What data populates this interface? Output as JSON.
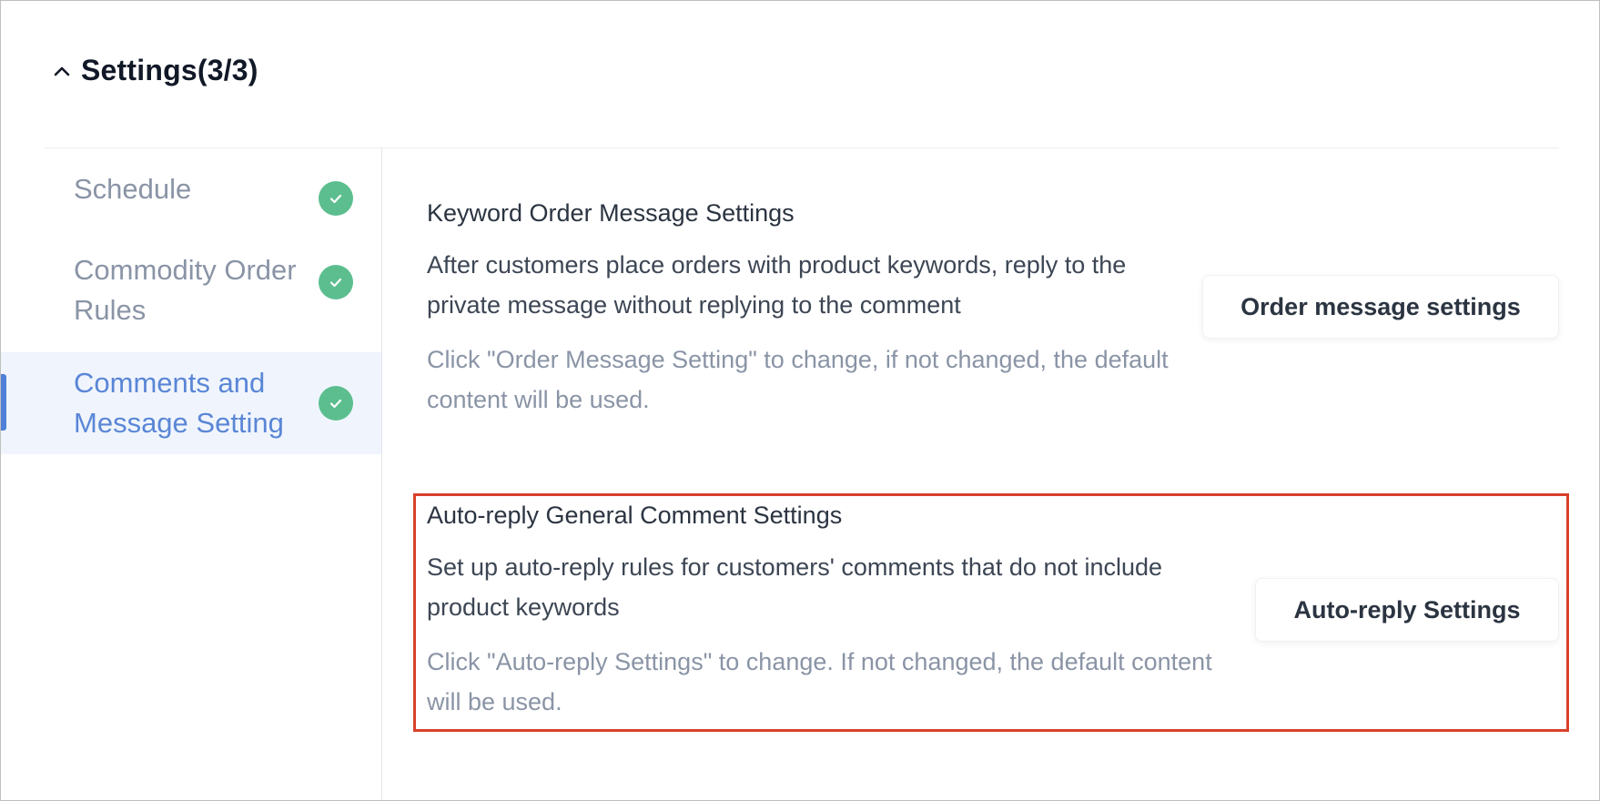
{
  "header": {
    "title": "Settings(3/3)",
    "toggle_icon": "chevron-up-icon"
  },
  "sidebar": {
    "items": [
      {
        "label": "Schedule",
        "status_icon": "check-circle-icon",
        "completed": true,
        "active": false
      },
      {
        "label": "Commodity Order Rules",
        "status_icon": "check-circle-icon",
        "completed": true,
        "active": false
      },
      {
        "label": "Comments and Message Setting",
        "status_icon": "check-circle-icon",
        "completed": true,
        "active": true
      }
    ]
  },
  "sections": [
    {
      "title": "Keyword Order Message Settings",
      "description": "After customers place orders with product keywords, reply to the private message without replying to the comment",
      "hint": "Click \"Order Message Setting\" to change, if not changed, the default content will be used.",
      "button_label": "Order message settings"
    },
    {
      "title": "Auto-reply General Comment Settings",
      "description": "Set up auto-reply rules for customers' comments that do not include product keywords",
      "hint": "Click \"Auto-reply Settings\" to change. If not changed, the default content will be used.",
      "button_label": "Auto-reply Settings",
      "highlighted": true
    }
  ],
  "colors": {
    "check": "#5cbe8f",
    "active_text": "#5a86d6",
    "active_bg": "#f0f5fd",
    "active_indicator": "#4f7fd8",
    "highlight_border": "#d9402c"
  }
}
